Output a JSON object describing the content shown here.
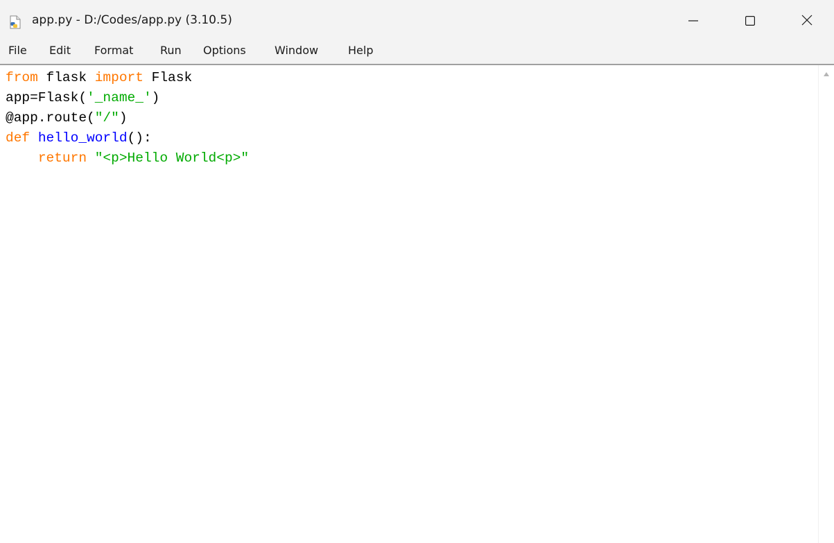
{
  "window": {
    "title": "app.py - D:/Codes/app.py (3.10.5)",
    "icon": "python-file-icon",
    "controls": {
      "minimize_icon": "minimize-icon",
      "maximize_icon": "maximize-icon",
      "close_icon": "close-icon"
    }
  },
  "menu": {
    "items": [
      "File",
      "Edit",
      "Format",
      "Run",
      "Options",
      "Window",
      "Help"
    ]
  },
  "editor": {
    "lines": [
      [
        {
          "text": "from",
          "type": "keyword"
        },
        {
          "text": " flask ",
          "type": "plain"
        },
        {
          "text": "import",
          "type": "keyword"
        },
        {
          "text": " Flask",
          "type": "plain"
        }
      ],
      [
        {
          "text": "app=Flask(",
          "type": "plain"
        },
        {
          "text": "'_name_'",
          "type": "string"
        },
        {
          "text": ")",
          "type": "plain"
        }
      ],
      [
        {
          "text": "@app.route(",
          "type": "plain"
        },
        {
          "text": "\"/\"",
          "type": "string"
        },
        {
          "text": ")",
          "type": "plain"
        }
      ],
      [
        {
          "text": "def",
          "type": "keyword"
        },
        {
          "text": " ",
          "type": "plain"
        },
        {
          "text": "hello_world",
          "type": "definition"
        },
        {
          "text": "():",
          "type": "plain"
        }
      ],
      [
        {
          "text": "    ",
          "type": "plain"
        },
        {
          "text": "return",
          "type": "keyword"
        },
        {
          "text": " ",
          "type": "plain"
        },
        {
          "text": "\"<p>Hello World<p>\"",
          "type": "string"
        }
      ]
    ]
  },
  "colors": {
    "keyword": "#ff7700",
    "string": "#00aa00",
    "definition": "#0000ff",
    "plain": "#000000",
    "chrome_background": "#f3f3f3",
    "editor_background": "#ffffff"
  }
}
